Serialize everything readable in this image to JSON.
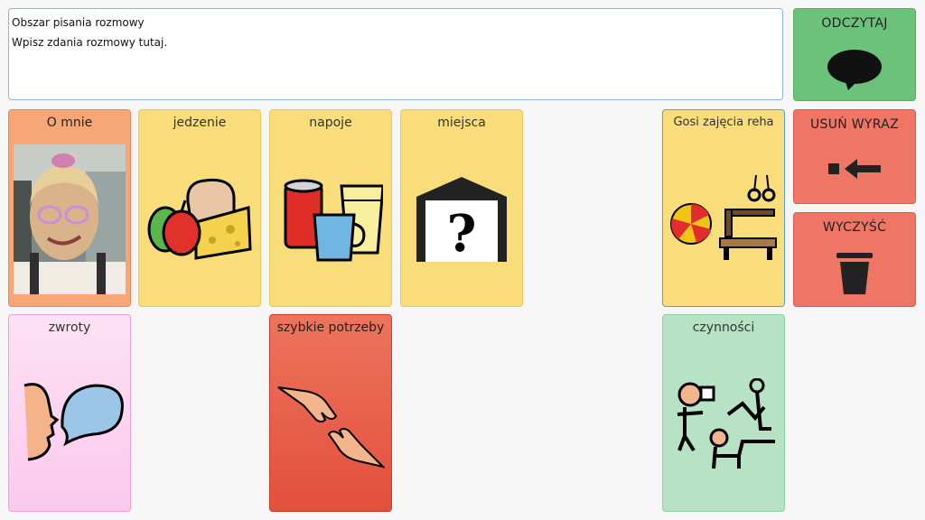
{
  "message_area": {
    "title": "Obszar pisania rozmowy",
    "placeholder": "Wpisz zdania rozmowy tutaj."
  },
  "controls": {
    "speak": {
      "label": "ODCZYTAJ",
      "icon": "speech-bubble-icon"
    },
    "delete_word": {
      "label": "USUŃ WYRAZ",
      "icon": "backspace-arrow-icon"
    },
    "clear": {
      "label": "WYCZYŚĆ",
      "icon": "trash-icon"
    }
  },
  "tiles": [
    {
      "label": "O mnie",
      "icon": "photo-of-girl",
      "color": "#f7a777"
    },
    {
      "label": "jedzenie",
      "icon": "food-icon",
      "color": "#f8dd7a"
    },
    {
      "label": "napoje",
      "icon": "drinks-icon",
      "color": "#f8dd7a"
    },
    {
      "label": "miejsca",
      "icon": "place-question-icon",
      "color": "#f8dd7a"
    },
    {
      "label": "Gosi zajęcia reha",
      "icon": "gym-equipment-icon",
      "color": "#f8dd7a"
    },
    {
      "label": "zwroty",
      "icon": "speaking-face-icon",
      "color": "#fbd2f1"
    },
    {
      "label": "szybkie potrzeby",
      "icon": "helping-hands-icon",
      "color": "#e86049"
    },
    {
      "label": "czynności",
      "icon": "activities-icon",
      "color": "#b7e3c4"
    }
  ]
}
